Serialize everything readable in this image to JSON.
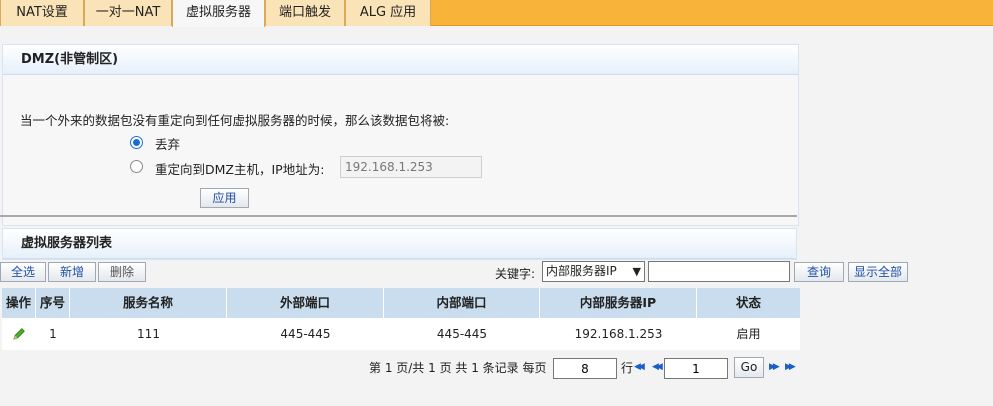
{
  "tabs": [
    {
      "label": "NAT设置",
      "active": false
    },
    {
      "label": "一对一NAT",
      "active": false
    },
    {
      "label": "虚拟服务器",
      "active": true
    },
    {
      "label": "端口触发",
      "active": false
    },
    {
      "label": "ALG 应用",
      "active": false
    }
  ],
  "dmz": {
    "title": "DMZ(非管制区)",
    "description": "当一个外来的数据包没有重定向到任何虚拟服务器的时候，那么该数据包将被:",
    "option_discard": "丢弃",
    "option_redirect": "重定向到DMZ主机，IP地址为:",
    "selected": "discard",
    "ip_value": "192.168.1.253",
    "apply_label": "应用"
  },
  "vs": {
    "title": "虚拟服务器列表",
    "select_all": "全选",
    "add": "新增",
    "delete": "删除",
    "keyword_label": "关键字:",
    "keyword_field": "内部服务器IP",
    "search_value": "",
    "query": "查询",
    "show_all": "显示全部",
    "columns": [
      "操作",
      "序号",
      "服务名称",
      "外部端口",
      "内部端口",
      "内部服务器IP",
      "状态"
    ],
    "rows": [
      {
        "index": "1",
        "name": "111",
        "ext_port": "445-445",
        "int_port": "445-445",
        "ip": "192.168.1.253",
        "status": "启用"
      }
    ]
  },
  "pager": {
    "summary": "第 1 页/共 1 页 共 1 条记录 每页",
    "per_page": "8",
    "row_unit": "行",
    "page": "1",
    "go": "Go"
  },
  "colors": {
    "accent": "#f7b33a",
    "header_blue": "#c9ddef",
    "link_blue": "#1f4fa8"
  },
  "icons": {
    "edit": "pencil-icon",
    "first": "first-page-icon",
    "prev": "prev-page-icon",
    "next": "next-page-icon",
    "last": "last-page-icon"
  }
}
